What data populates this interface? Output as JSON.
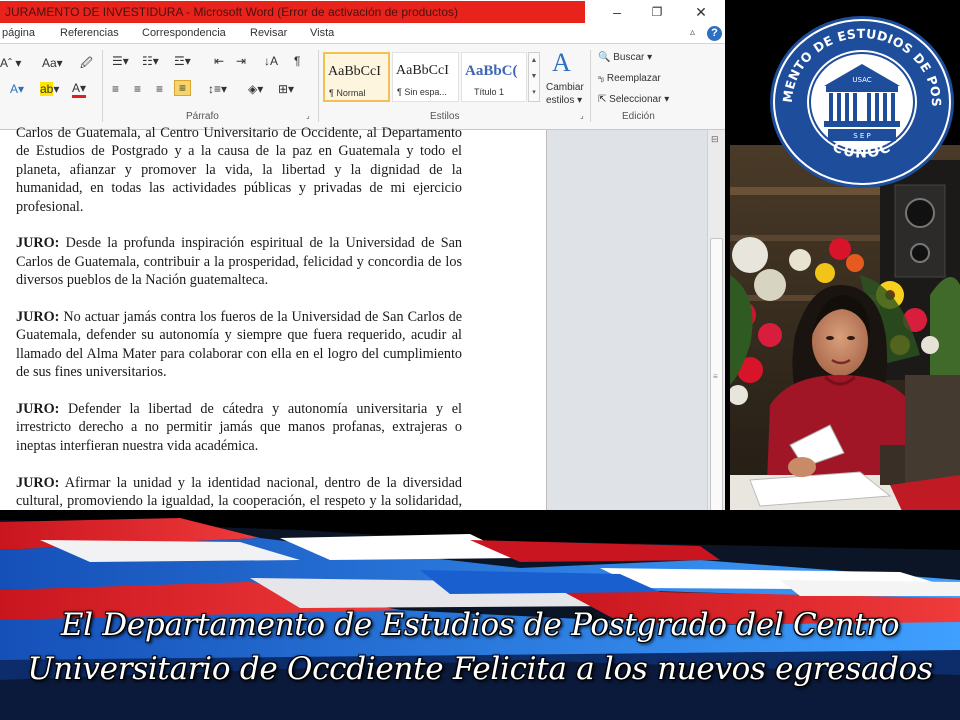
{
  "window": {
    "title": "JURAMENTO DE INVESTIDURA  -  Microsoft Word (Error de activación de productos)",
    "minimize_glyph": "–",
    "restore_glyph": "❐",
    "close_glyph": "✕"
  },
  "menu": {
    "items": [
      "página",
      "Referencias",
      "Correspondencia",
      "Revisar",
      "Vista"
    ],
    "help_glyph": "?"
  },
  "ribbon": {
    "paragraph_label": "Párrafo",
    "styles_label": "Estilos",
    "editing_label": "Edición",
    "styles": [
      {
        "preview": "AaBbCcI",
        "name": "¶ Normal"
      },
      {
        "preview": "AaBbCcI",
        "name": "¶ Sin espa..."
      },
      {
        "preview": "AaBbC(",
        "name": "Título 1"
      }
    ],
    "change_styles": [
      "Cambiar",
      "estilos ▾"
    ],
    "find": "Buscar ▾",
    "replace": "Reemplazar",
    "select": "Seleccionar ▾"
  },
  "document": {
    "paragraphs": [
      {
        "lead": "",
        "text": "Carlos de Guatemala, al Centro Universitario de Occidente, al Departamento de Estudios de Postgrado y a la causa de la paz en Guatemala y todo el planeta, afianzar y promover la vida, la libertad y la dignidad de la humanidad, en todas las actividades públicas y privadas de mi ejercicio profesional."
      },
      {
        "lead": "JURO:",
        "text": " Desde la profunda inspiración espiritual de la Universidad de San Carlos de Guatemala, contribuir a la prosperidad, felicidad y concordia de los diversos pueblos de la Nación guatemalteca."
      },
      {
        "lead": "JURO:",
        "text": " No actuar jamás contra los fueros de la Universidad de San Carlos de Guatemala, defender su autonomía y siempre que fuera requerido, acudir al llamado del Alma Mater para colaborar con ella en el logro del cumplimiento de sus fines universitarios."
      },
      {
        "lead": "JURO:",
        "text": " Defender la libertad de cátedra y autonomía universitaria y el irrestricto derecho a no permitir jamás que manos profanas, extrajeras o ineptas interfieran nuestra vida académica."
      },
      {
        "lead": "JURO:",
        "text": " Afirmar la unidad y la identidad nacional, dentro de la diversidad cultural, promoviendo la igualdad, la cooperación, el respeto y la solidaridad, dentro de la responsabilidad compartida entre"
      }
    ]
  },
  "logo": {
    "ring_top": "DEPARTAMENTO DE ESTUDIOS DE POSTGRADO",
    "ring_bottom": "CUNOC",
    "inner_top": "USAC",
    "inner_bottom": "S E P"
  },
  "caption": {
    "line1": "El Departamento de Estudios de Postgrado del Centro",
    "line2": "Universitario de Occdiente Felicita a los nuevos egresados"
  },
  "colors": {
    "title_bar": "#e8231b",
    "banner_red": "#d8202a",
    "banner_blue": "#1f6fd0",
    "logo_blue": "#1d4d9b"
  }
}
